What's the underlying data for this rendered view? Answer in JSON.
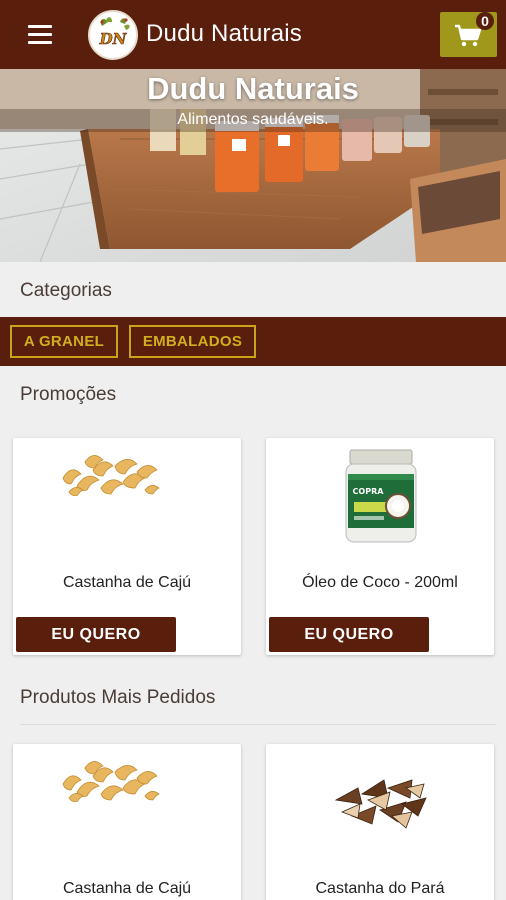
{
  "app": {
    "title": "Dudu Naturais",
    "logo_text": "DN",
    "cart_count": "0"
  },
  "hero": {
    "title": "Dudu Naturais",
    "subtitle": "Alimentos saudáveis."
  },
  "categories": {
    "heading": "Categorias",
    "items": [
      {
        "label": "A GRANEL"
      },
      {
        "label": "EMBALADOS"
      }
    ]
  },
  "promotions": {
    "heading": "Promoções",
    "products": [
      {
        "name": "Castanha de Cajú",
        "button": "EU QUERO",
        "image": "cashew-nuts"
      },
      {
        "name": "Óleo de Coco - 200ml",
        "button": "EU QUERO",
        "image": "coconut-oil-jar",
        "jar_label": "COPRA"
      }
    ]
  },
  "most_ordered": {
    "heading": "Produtos Mais Pedidos",
    "products": [
      {
        "name": "Castanha de Cajú",
        "image": "cashew-nuts"
      },
      {
        "name": "Castanha do Pará",
        "image": "brazil-nuts"
      }
    ]
  },
  "colors": {
    "brand_brown": "#5a1e0d",
    "cart_olive": "#a0981a",
    "category_gold": "#d4ad1e"
  }
}
